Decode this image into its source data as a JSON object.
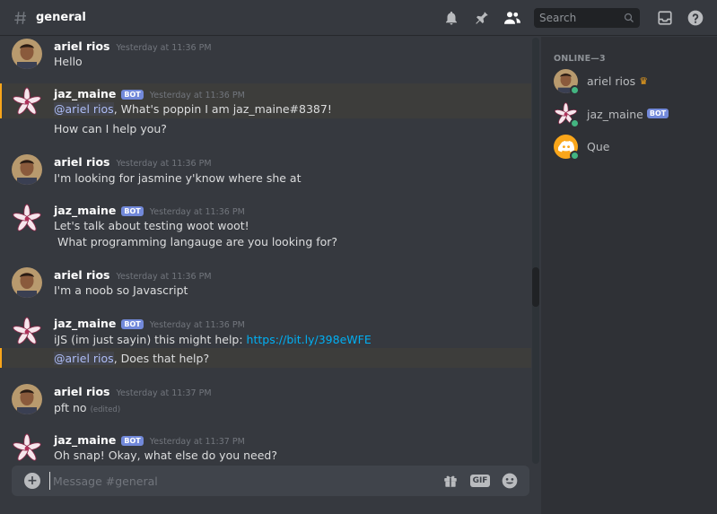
{
  "header": {
    "channel": "general",
    "search_placeholder": "Search"
  },
  "messages": [
    {
      "author": "ariel rios",
      "bot": false,
      "timestamp": "Yesterday at 11:36 PM",
      "lines": [
        "Hello"
      ]
    },
    {
      "author": "jaz_maine",
      "bot": true,
      "timestamp": "Yesterday at 11:36 PM",
      "mention": "@ariel rios",
      "mention_rest": ", What's poppin I am jaz_maine#8387!",
      "line2": "How can I help you?"
    },
    {
      "author": "ariel rios",
      "bot": false,
      "timestamp": "Yesterday at 11:36 PM",
      "lines": [
        "I'm looking for jasmine y'know where she at"
      ]
    },
    {
      "author": "jaz_maine",
      "bot": true,
      "timestamp": "Yesterday at 11:36 PM",
      "lines": [
        "Let's talk about testing woot woot!",
        " What programming langauge are you looking for?"
      ]
    },
    {
      "author": "ariel rios",
      "bot": false,
      "timestamp": "Yesterday at 11:36 PM",
      "lines": [
        "I'm a noob so Javascript"
      ]
    },
    {
      "author": "jaz_maine",
      "bot": true,
      "timestamp": "Yesterday at 11:36 PM",
      "text_before_link": "iJS (im just sayin) this might help: ",
      "link": "https://bit.ly/398eWFE",
      "mention": "@ariel rios",
      "mention_rest": ", Does that help?"
    },
    {
      "author": "ariel rios",
      "bot": false,
      "timestamp": "Yesterday at 11:37 PM",
      "lines": [
        "pft no"
      ],
      "edited": "(edited)"
    },
    {
      "author": "jaz_maine",
      "bot": true,
      "timestamp": "Yesterday at 11:37 PM",
      "lines": [
        "Oh snap! Okay, what else do you need?"
      ]
    }
  ],
  "bot_tag": "BOT",
  "composer": {
    "placeholder": "Message #general",
    "gif_label": "GIF"
  },
  "members": {
    "section_label": "ONLINE—3",
    "list": [
      {
        "name": "ariel rios",
        "owner": true
      },
      {
        "name": "jaz_maine",
        "bot": true
      },
      {
        "name": "Que"
      }
    ]
  },
  "colors": {
    "background": "#36393f",
    "sidebar": "#2f3136",
    "mention_highlight": "#faa61a",
    "bot_tag": "#7289da",
    "link": "#00b0f4",
    "online": "#43b581"
  },
  "icons": [
    "hash-icon",
    "bell-icon",
    "pin-icon",
    "members-icon",
    "search-icon",
    "inbox-icon",
    "help-icon",
    "plus-icon",
    "gift-icon",
    "gif-icon",
    "emoji-icon",
    "crown-icon"
  ]
}
